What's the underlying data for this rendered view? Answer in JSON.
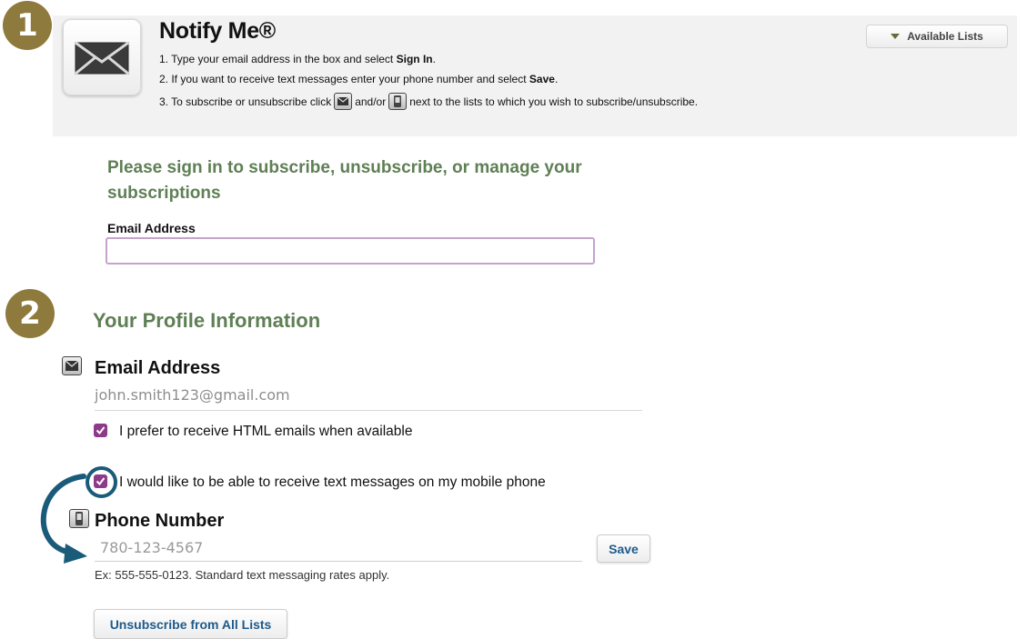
{
  "steps": {
    "one": "1",
    "two": "2"
  },
  "header": {
    "title": "Notify Me®",
    "instructions": [
      {
        "prefix": "1. Type your email address in the box and select ",
        "bold": "Sign In",
        "suffix": "."
      },
      {
        "prefix": "2. If you want to receive text messages enter your phone number and select ",
        "bold": "Save",
        "suffix": "."
      },
      {
        "prefix": "3. To subscribe or unsubscribe click ",
        "middle": " and/or ",
        "suffix": " next to the lists to which you wish to subscribe/unsubscribe."
      }
    ],
    "available_lists_label": "Available Lists"
  },
  "signin": {
    "heading": "Please sign in to subscribe, unsubscribe, or manage your subscriptions",
    "email_label": "Email Address",
    "email_value": ""
  },
  "profile": {
    "heading": "Your Profile Information",
    "email_title": "Email Address",
    "email_value": "john.smith123@gmail.com",
    "html_pref_label": "I prefer to receive HTML emails when available",
    "html_pref_checked": true,
    "text_pref_label": "I would like to be able to receive text messages on my mobile phone",
    "text_pref_checked": true,
    "phone_title": "Phone Number",
    "phone_value": "780-123-4567",
    "save_label": "Save",
    "phone_hint": "Ex: 555-555-0123. Standard text messaging rates apply.",
    "unsubscribe_label": "Unsubscribe from All Lists"
  },
  "icons": {
    "envelope": "envelope-icon",
    "phone": "mobile-phone-icon",
    "check": "checkmark-icon",
    "arrow": "curved-arrow-icon"
  },
  "colors": {
    "step_badge": "#8f7a3d",
    "heading_green": "#5f7f55",
    "checkbox_purple": "#8e3a8a",
    "input_focus_border": "#c5a3cc",
    "button_text_blue": "#1f5a8a",
    "annotation_blue": "#1a5b7a",
    "header_bg": "#f2f2f2"
  }
}
